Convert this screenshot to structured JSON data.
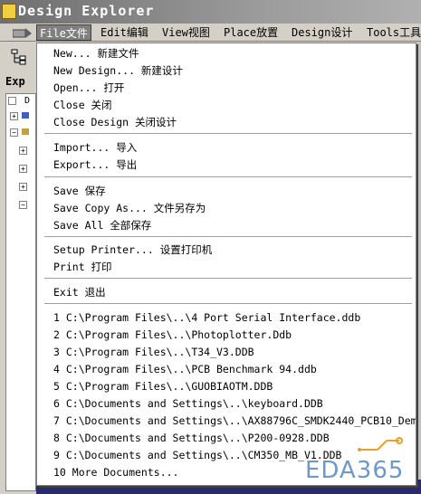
{
  "window": {
    "title": "Design Explorer"
  },
  "menubar": {
    "items": [
      {
        "label": "File文件",
        "active": true
      },
      {
        "label": "Edit编辑"
      },
      {
        "label": "View视图"
      },
      {
        "label": "Place放置"
      },
      {
        "label": "Design设计"
      },
      {
        "label": "Tools工具"
      }
    ]
  },
  "left_panel": {
    "tab_label": "Exp",
    "tree_label": "D"
  },
  "file_menu": {
    "groups": [
      [
        "New...  新建文件",
        "New Design...  新建设计",
        "Open... 打开",
        "Close 关闭",
        "Close Design 关闭设计"
      ],
      [
        "Import...  导入",
        "Export...  导出"
      ],
      [
        "Save  保存",
        "Save Copy As...  文件另存为",
        "Save All 全部保存"
      ],
      [
        "Setup Printer... 设置打印机",
        "Print 打印"
      ],
      [
        "Exit 退出"
      ],
      [
        "1 C:\\Program Files\\..\\4 Port Serial Interface.ddb",
        "2 C:\\Program Files\\..\\Photoplotter.Ddb",
        "3 C:\\Program Files\\..\\T34_V3.DDB",
        "4 C:\\Program Files\\..\\PCB Benchmark 94.ddb",
        "5 C:\\Program Files\\..\\GUOBIAOTM.DDB",
        "6 C:\\Documents and Settings\\..\\keyboard.DDB",
        "7 C:\\Documents and Settings\\..\\AX88796C_SMDK2440_PCB10_Dem",
        "8 C:\\Documents and Settings\\..\\P200-0928.DDB",
        "9 C:\\Documents and Settings\\..\\CM350_MB_V1.DDB",
        "10 More Documents..."
      ]
    ]
  },
  "watermark": {
    "text": "EDA365"
  },
  "colors": {
    "menu_highlight": "#808080",
    "title_bar": "#808080",
    "watermark": "#2f6fb0"
  }
}
